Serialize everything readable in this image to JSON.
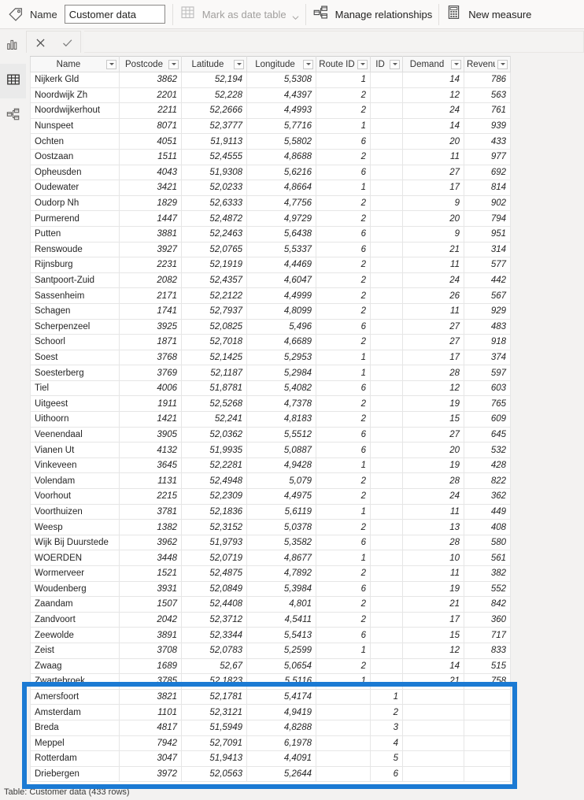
{
  "ribbon": {
    "tag_icon": "tag-icon",
    "name_label": "Name",
    "name_value": "Customer data",
    "mark_as_date_table": {
      "icon": "calendar-table-icon",
      "label": "Mark as date table",
      "chevron": "chevron-down-icon",
      "enabled": false
    },
    "manage_relationships": {
      "icon": "relationships-icon",
      "label": "Manage relationships",
      "enabled": true
    },
    "new_measure": {
      "icon": "calculator-icon",
      "label": "New measure",
      "enabled": true
    }
  },
  "rail": {
    "items": [
      {
        "name": "report-view",
        "icon": "bar-chart-icon",
        "active": false
      },
      {
        "name": "data-view",
        "icon": "table-grid-icon",
        "active": true
      },
      {
        "name": "model-view",
        "icon": "model-relationships-icon",
        "active": false
      }
    ]
  },
  "formula_bar": {
    "cancel_icon": "close-x-icon",
    "accept_icon": "checkmark-icon",
    "value": "",
    "placeholder": ""
  },
  "grid": {
    "columns": [
      {
        "label": "Name",
        "key": "name",
        "type": "text",
        "width_class": "w-name"
      },
      {
        "label": "Postcode",
        "key": "post",
        "type": "num",
        "width_class": "w-post"
      },
      {
        "label": "Latitude",
        "key": "lat",
        "type": "num",
        "width_class": "w-lat"
      },
      {
        "label": "Longitude",
        "key": "lng",
        "type": "num",
        "width_class": "w-lng"
      },
      {
        "label": "Route ID",
        "key": "route",
        "type": "num",
        "width_class": "w-route"
      },
      {
        "label": "ID",
        "key": "id",
        "type": "num",
        "width_class": "w-id"
      },
      {
        "label": "Demand",
        "key": "demand",
        "type": "num",
        "width_class": "w-dem"
      },
      {
        "label": "Revenue",
        "key": "rev",
        "type": "num",
        "width_class": "w-rev"
      }
    ],
    "filter_icon": "filter-caret-icon",
    "rows": [
      {
        "name": "Nijkerk Gld",
        "post": "3862",
        "lat": "52,194",
        "lng": "5,5308",
        "route": "1",
        "id": "",
        "demand": "14",
        "rev": "786",
        "highlighted": false
      },
      {
        "name": "Noordwijk Zh",
        "post": "2201",
        "lat": "52,228",
        "lng": "4,4397",
        "route": "2",
        "id": "",
        "demand": "12",
        "rev": "563",
        "highlighted": false
      },
      {
        "name": "Noordwijkerhout",
        "post": "2211",
        "lat": "52,2666",
        "lng": "4,4993",
        "route": "2",
        "id": "",
        "demand": "24",
        "rev": "761",
        "highlighted": false
      },
      {
        "name": "Nunspeet",
        "post": "8071",
        "lat": "52,3777",
        "lng": "5,7716",
        "route": "1",
        "id": "",
        "demand": "14",
        "rev": "939",
        "highlighted": false
      },
      {
        "name": "Ochten",
        "post": "4051",
        "lat": "51,9113",
        "lng": "5,5802",
        "route": "6",
        "id": "",
        "demand": "20",
        "rev": "433",
        "highlighted": false
      },
      {
        "name": "Oostzaan",
        "post": "1511",
        "lat": "52,4555",
        "lng": "4,8688",
        "route": "2",
        "id": "",
        "demand": "11",
        "rev": "977",
        "highlighted": false
      },
      {
        "name": "Opheusden",
        "post": "4043",
        "lat": "51,9308",
        "lng": "5,6216",
        "route": "6",
        "id": "",
        "demand": "27",
        "rev": "692",
        "highlighted": false
      },
      {
        "name": "Oudewater",
        "post": "3421",
        "lat": "52,0233",
        "lng": "4,8664",
        "route": "1",
        "id": "",
        "demand": "17",
        "rev": "814",
        "highlighted": false
      },
      {
        "name": "Oudorp Nh",
        "post": "1829",
        "lat": "52,6333",
        "lng": "4,7756",
        "route": "2",
        "id": "",
        "demand": "9",
        "rev": "902",
        "highlighted": false
      },
      {
        "name": "Purmerend",
        "post": "1447",
        "lat": "52,4872",
        "lng": "4,9729",
        "route": "2",
        "id": "",
        "demand": "20",
        "rev": "794",
        "highlighted": false
      },
      {
        "name": "Putten",
        "post": "3881",
        "lat": "52,2463",
        "lng": "5,6438",
        "route": "6",
        "id": "",
        "demand": "9",
        "rev": "951",
        "highlighted": false
      },
      {
        "name": "Renswoude",
        "post": "3927",
        "lat": "52,0765",
        "lng": "5,5337",
        "route": "6",
        "id": "",
        "demand": "21",
        "rev": "314",
        "highlighted": false
      },
      {
        "name": "Rijnsburg",
        "post": "2231",
        "lat": "52,1919",
        "lng": "4,4469",
        "route": "2",
        "id": "",
        "demand": "11",
        "rev": "577",
        "highlighted": false
      },
      {
        "name": "Santpoort-Zuid",
        "post": "2082",
        "lat": "52,4357",
        "lng": "4,6047",
        "route": "2",
        "id": "",
        "demand": "24",
        "rev": "442",
        "highlighted": false
      },
      {
        "name": "Sassenheim",
        "post": "2171",
        "lat": "52,2122",
        "lng": "4,4999",
        "route": "2",
        "id": "",
        "demand": "26",
        "rev": "567",
        "highlighted": false
      },
      {
        "name": "Schagen",
        "post": "1741",
        "lat": "52,7937",
        "lng": "4,8099",
        "route": "2",
        "id": "",
        "demand": "11",
        "rev": "929",
        "highlighted": false
      },
      {
        "name": "Scherpenzeel",
        "post": "3925",
        "lat": "52,0825",
        "lng": "5,496",
        "route": "6",
        "id": "",
        "demand": "27",
        "rev": "483",
        "highlighted": false
      },
      {
        "name": "Schoorl",
        "post": "1871",
        "lat": "52,7018",
        "lng": "4,6689",
        "route": "2",
        "id": "",
        "demand": "27",
        "rev": "918",
        "highlighted": false
      },
      {
        "name": "Soest",
        "post": "3768",
        "lat": "52,1425",
        "lng": "5,2953",
        "route": "1",
        "id": "",
        "demand": "17",
        "rev": "374",
        "highlighted": false
      },
      {
        "name": "Soesterberg",
        "post": "3769",
        "lat": "52,1187",
        "lng": "5,2984",
        "route": "1",
        "id": "",
        "demand": "28",
        "rev": "597",
        "highlighted": false
      },
      {
        "name": "Tiel",
        "post": "4006",
        "lat": "51,8781",
        "lng": "5,4082",
        "route": "6",
        "id": "",
        "demand": "12",
        "rev": "603",
        "highlighted": false
      },
      {
        "name": "Uitgeest",
        "post": "1911",
        "lat": "52,5268",
        "lng": "4,7378",
        "route": "2",
        "id": "",
        "demand": "19",
        "rev": "765",
        "highlighted": false
      },
      {
        "name": "Uithoorn",
        "post": "1421",
        "lat": "52,241",
        "lng": "4,8183",
        "route": "2",
        "id": "",
        "demand": "15",
        "rev": "609",
        "highlighted": false
      },
      {
        "name": "Veenendaal",
        "post": "3905",
        "lat": "52,0362",
        "lng": "5,5512",
        "route": "6",
        "id": "",
        "demand": "27",
        "rev": "645",
        "highlighted": false
      },
      {
        "name": "Vianen Ut",
        "post": "4132",
        "lat": "51,9935",
        "lng": "5,0887",
        "route": "6",
        "id": "",
        "demand": "20",
        "rev": "532",
        "highlighted": false
      },
      {
        "name": "Vinkeveen",
        "post": "3645",
        "lat": "52,2281",
        "lng": "4,9428",
        "route": "1",
        "id": "",
        "demand": "19",
        "rev": "428",
        "highlighted": false
      },
      {
        "name": "Volendam",
        "post": "1131",
        "lat": "52,4948",
        "lng": "5,079",
        "route": "2",
        "id": "",
        "demand": "28",
        "rev": "822",
        "highlighted": false
      },
      {
        "name": "Voorhout",
        "post": "2215",
        "lat": "52,2309",
        "lng": "4,4975",
        "route": "2",
        "id": "",
        "demand": "24",
        "rev": "362",
        "highlighted": false
      },
      {
        "name": "Voorthuizen",
        "post": "3781",
        "lat": "52,1836",
        "lng": "5,6119",
        "route": "1",
        "id": "",
        "demand": "11",
        "rev": "449",
        "highlighted": false
      },
      {
        "name": "Weesp",
        "post": "1382",
        "lat": "52,3152",
        "lng": "5,0378",
        "route": "2",
        "id": "",
        "demand": "13",
        "rev": "408",
        "highlighted": false
      },
      {
        "name": "Wijk Bij Duurstede",
        "post": "3962",
        "lat": "51,9793",
        "lng": "5,3582",
        "route": "6",
        "id": "",
        "demand": "28",
        "rev": "580",
        "highlighted": false
      },
      {
        "name": "WOERDEN",
        "post": "3448",
        "lat": "52,0719",
        "lng": "4,8677",
        "route": "1",
        "id": "",
        "demand": "10",
        "rev": "561",
        "highlighted": false
      },
      {
        "name": "Wormerveer",
        "post": "1521",
        "lat": "52,4875",
        "lng": "4,7892",
        "route": "2",
        "id": "",
        "demand": "11",
        "rev": "382",
        "highlighted": false
      },
      {
        "name": "Woudenberg",
        "post": "3931",
        "lat": "52,0849",
        "lng": "5,3984",
        "route": "6",
        "id": "",
        "demand": "19",
        "rev": "552",
        "highlighted": false
      },
      {
        "name": "Zaandam",
        "post": "1507",
        "lat": "52,4408",
        "lng": "4,801",
        "route": "2",
        "id": "",
        "demand": "21",
        "rev": "842",
        "highlighted": false
      },
      {
        "name": "Zandvoort",
        "post": "2042",
        "lat": "52,3712",
        "lng": "4,5411",
        "route": "2",
        "id": "",
        "demand": "17",
        "rev": "360",
        "highlighted": false
      },
      {
        "name": "Zeewolde",
        "post": "3891",
        "lat": "52,3344",
        "lng": "5,5413",
        "route": "6",
        "id": "",
        "demand": "15",
        "rev": "717",
        "highlighted": false
      },
      {
        "name": "Zeist",
        "post": "3708",
        "lat": "52,0783",
        "lng": "5,2599",
        "route": "1",
        "id": "",
        "demand": "12",
        "rev": "833",
        "highlighted": false
      },
      {
        "name": "Zwaag",
        "post": "1689",
        "lat": "52,67",
        "lng": "5,0654",
        "route": "2",
        "id": "",
        "demand": "14",
        "rev": "515",
        "highlighted": false
      },
      {
        "name": "Zwartebroek",
        "post": "3785",
        "lat": "52,1823",
        "lng": "5,5116",
        "route": "1",
        "id": "",
        "demand": "21",
        "rev": "758",
        "highlighted": false
      },
      {
        "name": "Amersfoort",
        "post": "3821",
        "lat": "52,1781",
        "lng": "5,4174",
        "route": "",
        "id": "1",
        "demand": "",
        "rev": "",
        "highlighted": true
      },
      {
        "name": "Amsterdam",
        "post": "1101",
        "lat": "52,3121",
        "lng": "4,9419",
        "route": "",
        "id": "2",
        "demand": "",
        "rev": "",
        "highlighted": true
      },
      {
        "name": "Breda",
        "post": "4817",
        "lat": "51,5949",
        "lng": "4,8288",
        "route": "",
        "id": "3",
        "demand": "",
        "rev": "",
        "highlighted": true
      },
      {
        "name": "Meppel",
        "post": "7942",
        "lat": "52,7091",
        "lng": "6,1978",
        "route": "",
        "id": "4",
        "demand": "",
        "rev": "",
        "highlighted": true
      },
      {
        "name": "Rotterdam",
        "post": "3047",
        "lat": "51,9413",
        "lng": "4,4091",
        "route": "",
        "id": "5",
        "demand": "",
        "rev": "",
        "highlighted": true
      },
      {
        "name": "Driebergen",
        "post": "3972",
        "lat": "52,0563",
        "lng": "5,2644",
        "route": "",
        "id": "6",
        "demand": "",
        "rev": "",
        "highlighted": true
      }
    ]
  },
  "highlight": {
    "color": "#1b7ad3",
    "name": "highlight-annotation-box"
  },
  "status_bar": {
    "text": "Table: Customer data (433 rows)"
  }
}
